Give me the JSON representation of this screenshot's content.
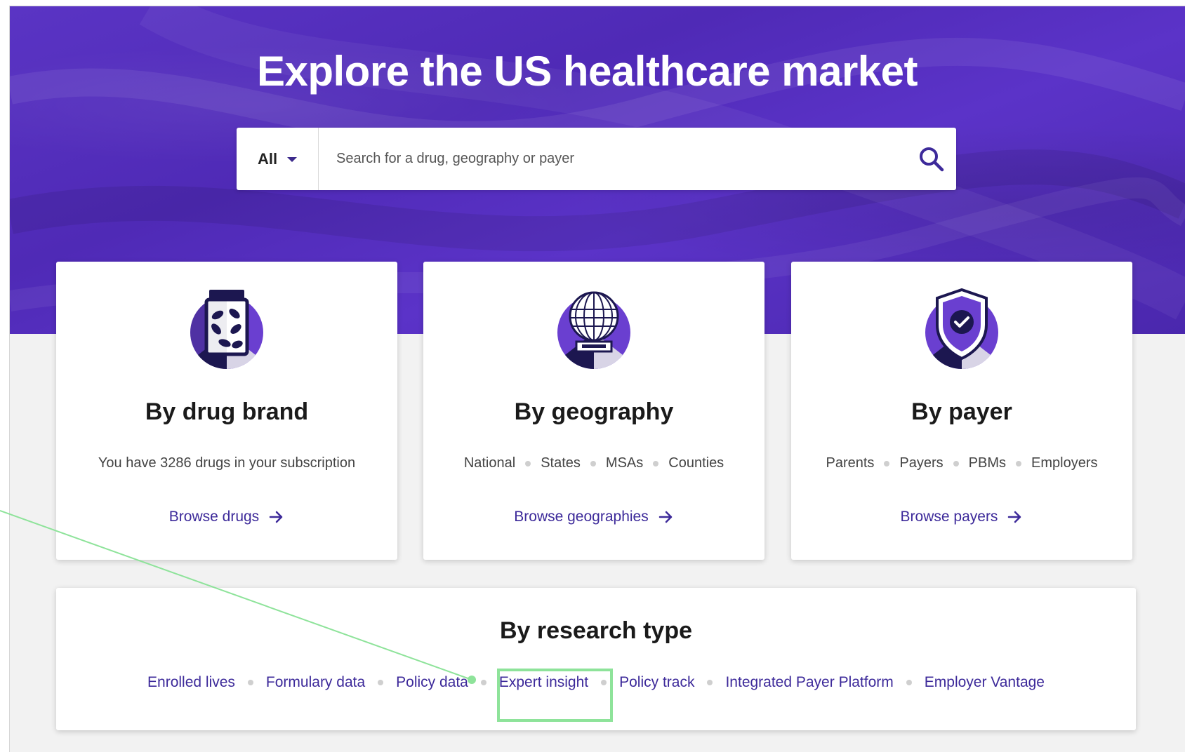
{
  "hero": {
    "title": "Explore the US healthcare market"
  },
  "search": {
    "scope_label": "All",
    "placeholder": "Search for a drug, geography or payer",
    "search_icon": "search-icon"
  },
  "cards": {
    "drug": {
      "title": "By drug brand",
      "subtitle": "You have 3286 drugs in your subscription",
      "link": "Browse drugs",
      "icon": "pill-bottle-icon"
    },
    "geography": {
      "title": "By geography",
      "tags": [
        "National",
        "States",
        "MSAs",
        "Counties"
      ],
      "link": "Browse geographies",
      "icon": "globe-icon"
    },
    "payer": {
      "title": "By payer",
      "tags": [
        "Parents",
        "Payers",
        "PBMs",
        "Employers"
      ],
      "link": "Browse payers",
      "icon": "shield-check-icon"
    }
  },
  "research": {
    "title": "By research type",
    "links": [
      "Enrolled lives",
      "Formulary data",
      "Policy data",
      "Expert insight",
      "Policy track",
      "Integrated Payer Platform",
      "Employer Vantage"
    ],
    "highlighted": "Expert insight"
  },
  "colors": {
    "hero": "#5a34c4",
    "link": "#3d2a9a",
    "annotation": "#8ee39a",
    "icon_dark": "#1c1750",
    "icon_purple": "#6a3fd0"
  }
}
